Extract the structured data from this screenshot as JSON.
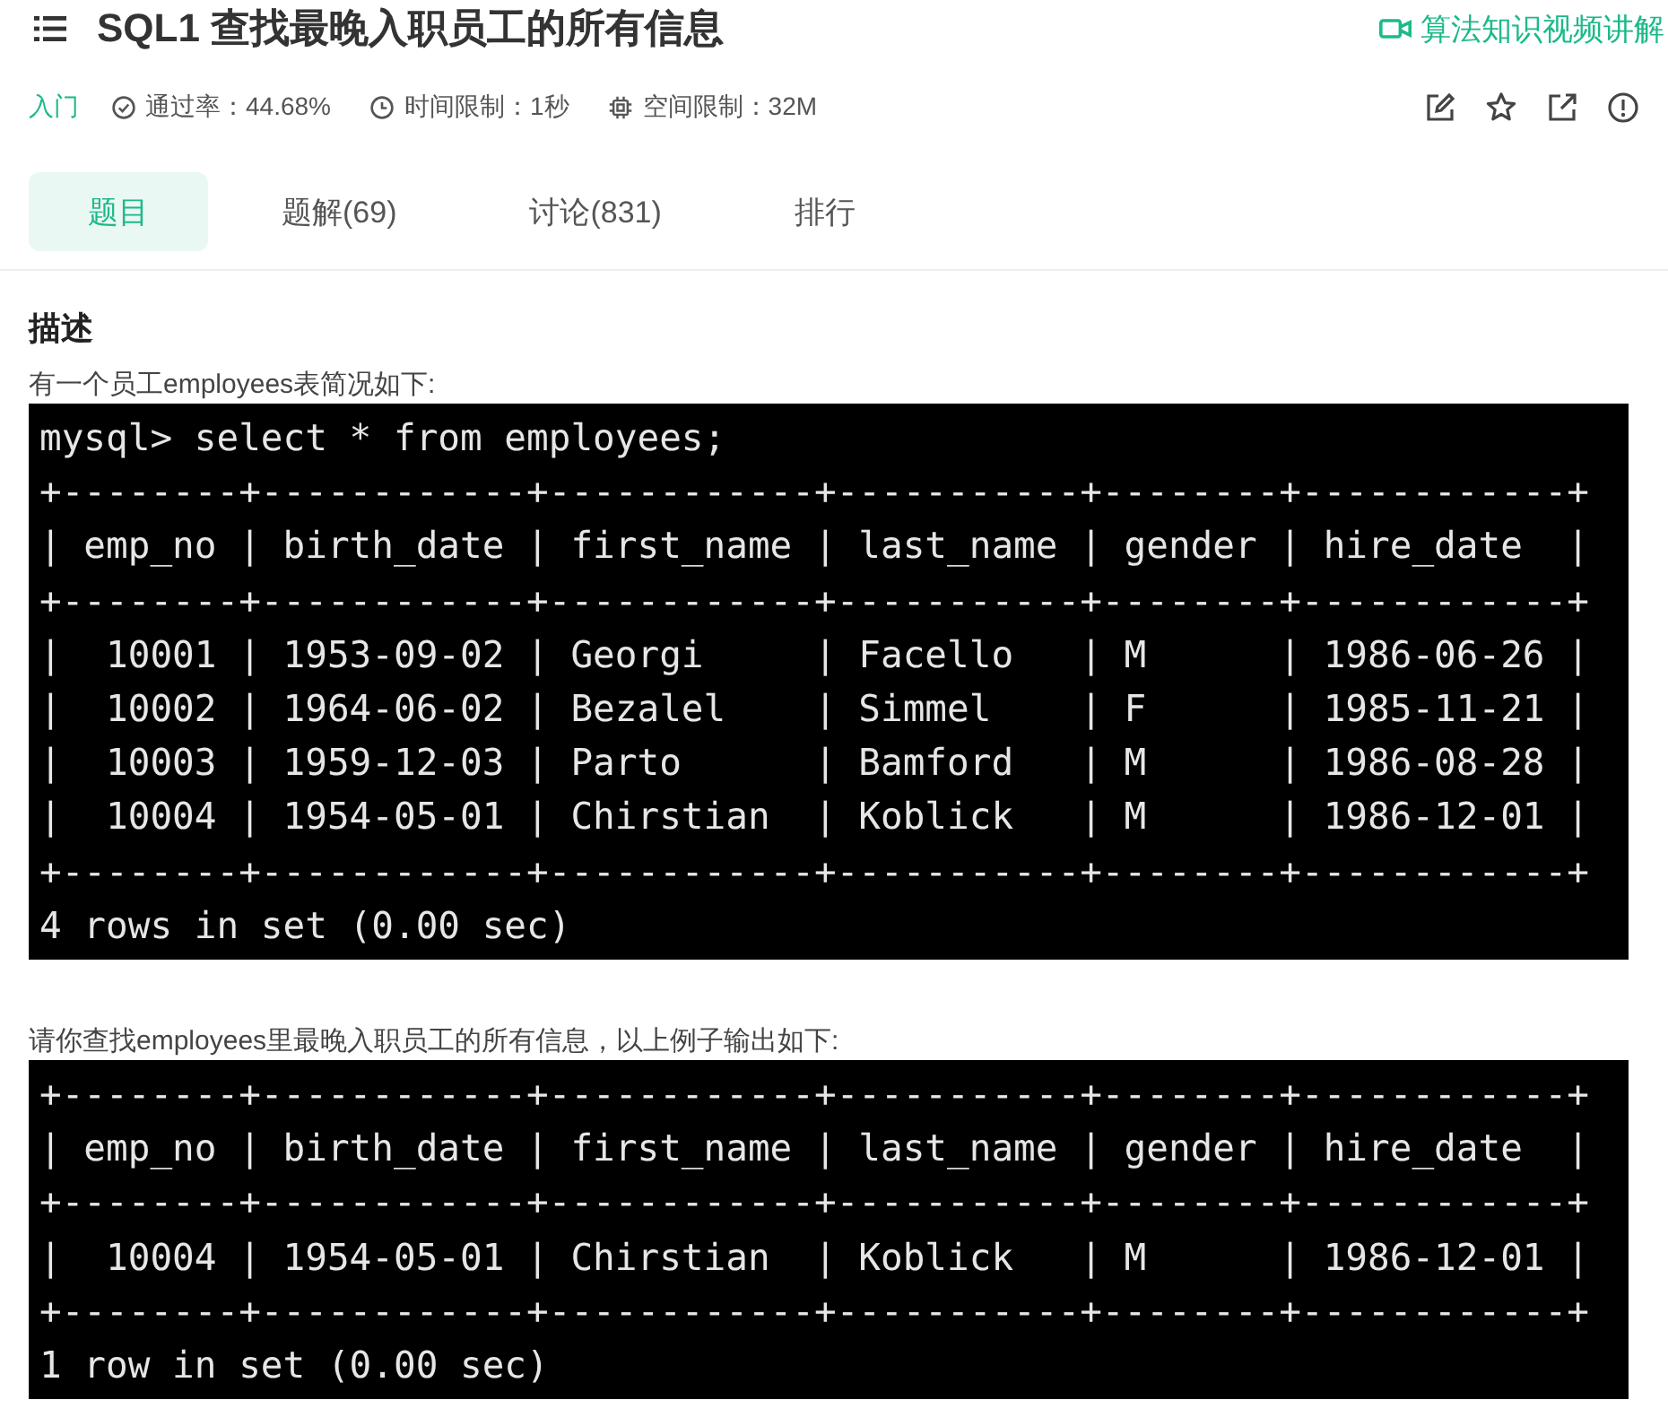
{
  "header": {
    "title": "SQL1  查找最晚入职员工的所有信息",
    "video_link": "算法知识视频讲解"
  },
  "meta": {
    "difficulty": "入门",
    "pass_rate": "通过率：44.68%",
    "time_limit": "时间限制：1秒",
    "memory_limit": "空间限制：32M"
  },
  "tabs": [
    {
      "label": "题目",
      "selected": true
    },
    {
      "label": "题解(69)",
      "selected": false
    },
    {
      "label": "讨论(831)",
      "selected": false
    },
    {
      "label": "排行",
      "selected": false
    }
  ],
  "description": {
    "heading": "描述",
    "blocks": [
      {
        "kind": "text",
        "text": "有一个员工employees表简况如下:"
      },
      {
        "kind": "terminal",
        "lines": [
          "mysql> select * from employees;",
          "+--------+------------+------------+-----------+--------+------------+",
          "| emp_no | birth_date | first_name | last_name | gender | hire_date  |",
          "+--------+------------+------------+-----------+--------+------------+",
          "|  10001 | 1953-09-02 | Georgi     | Facello   | M      | 1986-06-26 |",
          "|  10002 | 1964-06-02 | Bezalel    | Simmel    | F      | 1985-11-21 |",
          "|  10003 | 1959-12-03 | Parto      | Bamford   | M      | 1986-08-28 |",
          "|  10004 | 1954-05-01 | Chirstian  | Koblick   | M      | 1986-12-01 |",
          "+--------+------------+------------+-----------+--------+------------+",
          "4 rows in set (0.00 sec)"
        ]
      },
      {
        "kind": "text",
        "text": "请你查找employees里最晚入职员工的所有信息，以上例子输出如下:"
      },
      {
        "kind": "terminal",
        "lines": [
          "+--------+------------+------------+-----------+--------+------------+",
          "| emp_no | birth_date | first_name | last_name | gender | hire_date  |",
          "+--------+------------+------------+-----------+--------+------------+",
          "|  10004 | 1954-05-01 | Chirstian  | Koblick   | M      | 1986-12-01 |",
          "+--------+------------+------------+-----------+--------+------------+",
          "1 row in set (0.00 sec)"
        ]
      }
    ]
  }
}
